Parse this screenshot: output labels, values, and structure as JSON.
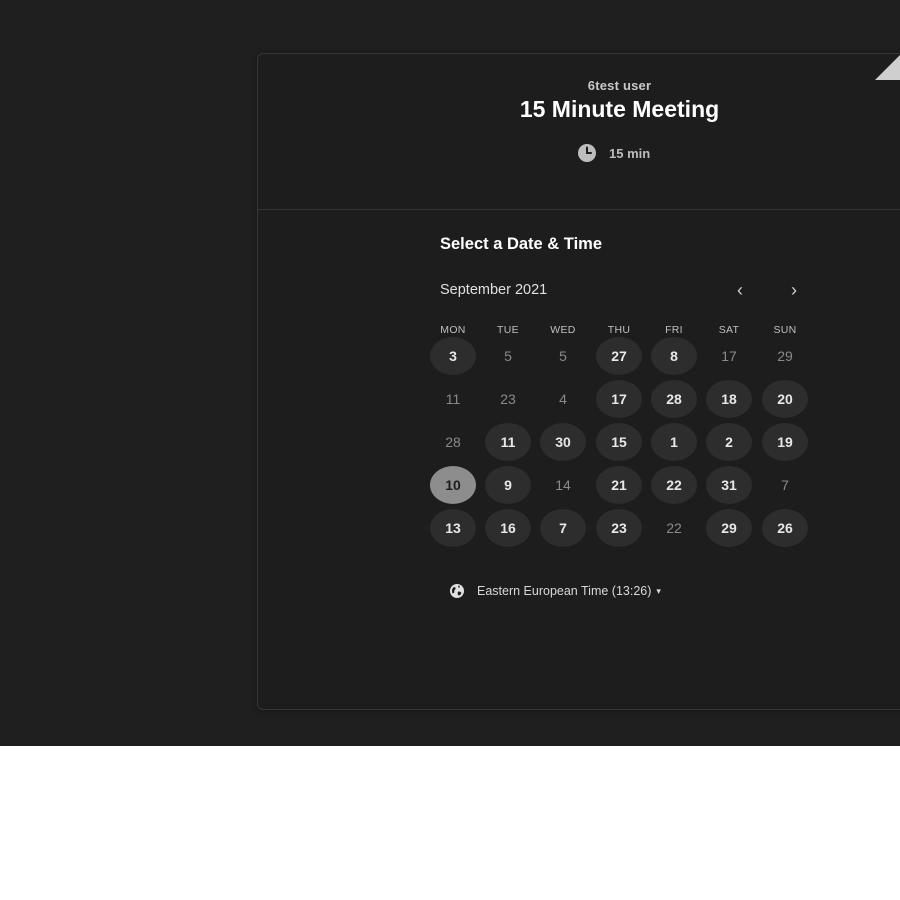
{
  "header": {
    "host_name": "6test user",
    "event_title": "15 Minute Meeting",
    "duration": "15 min",
    "duration_icon": "clock-icon"
  },
  "calendar": {
    "section_title": "Select a Date & Time",
    "month_label": "September 2021",
    "prev_icon": "chevron-left-icon",
    "next_icon": "chevron-right-icon",
    "prev_glyph": "‹",
    "next_glyph": "›",
    "weekdays": [
      "MON",
      "TUE",
      "WED",
      "THU",
      "FRI",
      "SAT",
      "SUN"
    ],
    "weeks": [
      [
        {
          "label": "3",
          "state": "available"
        },
        {
          "label": "5",
          "state": "unavailable"
        },
        {
          "label": "5",
          "state": "unavailable"
        },
        {
          "label": "27",
          "state": "available"
        },
        {
          "label": "8",
          "state": "available"
        },
        {
          "label": "17",
          "state": "unavailable"
        },
        {
          "label": "29",
          "state": "unavailable"
        }
      ],
      [
        {
          "label": "11",
          "state": "unavailable"
        },
        {
          "label": "23",
          "state": "unavailable"
        },
        {
          "label": "4",
          "state": "unavailable"
        },
        {
          "label": "17",
          "state": "available"
        },
        {
          "label": "28",
          "state": "available"
        },
        {
          "label": "18",
          "state": "available"
        },
        {
          "label": "20",
          "state": "available"
        }
      ],
      [
        {
          "label": "28",
          "state": "unavailable"
        },
        {
          "label": "11",
          "state": "available"
        },
        {
          "label": "30",
          "state": "available"
        },
        {
          "label": "15",
          "state": "available"
        },
        {
          "label": "1",
          "state": "available"
        },
        {
          "label": "2",
          "state": "available"
        },
        {
          "label": "19",
          "state": "available"
        }
      ],
      [
        {
          "label": "10",
          "state": "selected"
        },
        {
          "label": "9",
          "state": "available"
        },
        {
          "label": "14",
          "state": "unavailable"
        },
        {
          "label": "21",
          "state": "available"
        },
        {
          "label": "22",
          "state": "available"
        },
        {
          "label": "31",
          "state": "available"
        },
        {
          "label": "7",
          "state": "unavailable"
        }
      ],
      [
        {
          "label": "13",
          "state": "available"
        },
        {
          "label": "16",
          "state": "available"
        },
        {
          "label": "7",
          "state": "available"
        },
        {
          "label": "23",
          "state": "available"
        },
        {
          "label": "22",
          "state": "unavailable"
        },
        {
          "label": "29",
          "state": "available"
        },
        {
          "label": "26",
          "state": "available"
        }
      ]
    ]
  },
  "timezone": {
    "label": "Eastern European Time (13:26)",
    "icon": "globe-icon",
    "caret": "▾"
  },
  "colors": {
    "page_background": "#1f1f1f",
    "card_background": "#1d1d1d",
    "available_day": "#2d2d2d",
    "selected_day": "#8d8d8d"
  }
}
